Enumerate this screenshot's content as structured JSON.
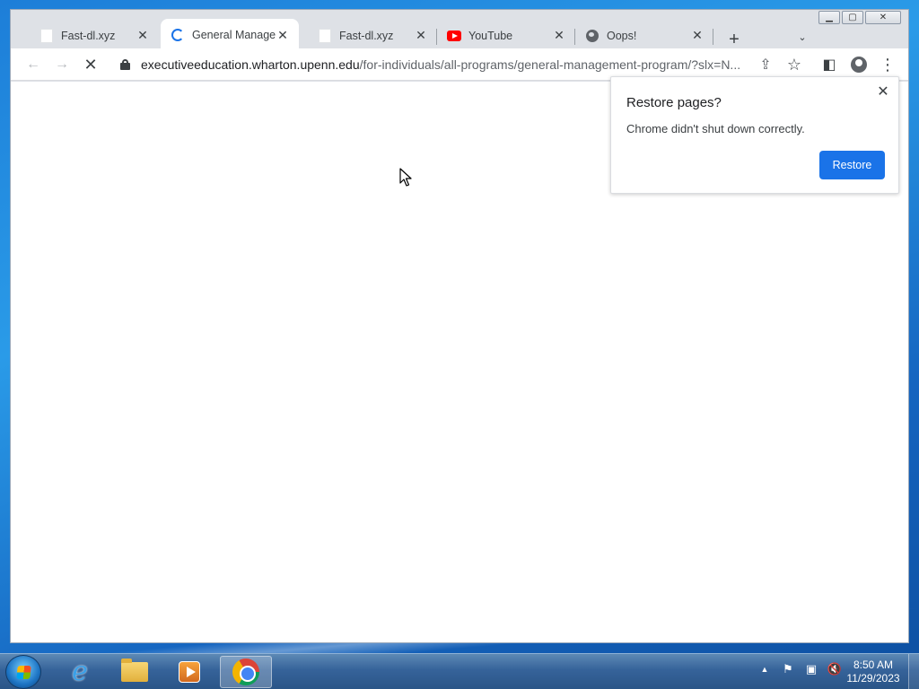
{
  "window": {
    "controls": {
      "minimize": "▁",
      "maximize": "▢",
      "close": "✕"
    }
  },
  "tabs": [
    {
      "title": "Fast-dl.xyz",
      "icon": "blank-page-icon",
      "active": false
    },
    {
      "title": "General Management",
      "icon": "loading-spinner-icon",
      "active": true
    },
    {
      "title": "Fast-dl.xyz",
      "icon": "blank-page-icon",
      "active": false
    },
    {
      "title": "YouTube",
      "icon": "youtube-icon",
      "active": false
    },
    {
      "title": "Oops!",
      "icon": "globe-icon",
      "active": false
    }
  ],
  "tabstrip": {
    "new_tab": "+",
    "tab_search": "⌄",
    "close_glyph": "✕"
  },
  "toolbar": {
    "back": "←",
    "forward": "→",
    "stop": "✕",
    "url_host": "executiveeducation.wharton.upenn.edu",
    "url_path": "/for-individuals/all-programs/general-management-program/?slx=N...",
    "share": "⇪",
    "bookmark": "☆",
    "side_panel": "◧",
    "menu": "⋮"
  },
  "restore_bubble": {
    "title": "Restore pages?",
    "message": "Chrome didn't shut down correctly.",
    "button": "Restore",
    "close": "✕"
  },
  "taskbar": {
    "apps": [
      "start-button",
      "internet-explorer",
      "file-explorer",
      "media-player",
      "google-chrome"
    ],
    "tray": {
      "show_hidden": "▲",
      "flag": "⚑",
      "network": "▣",
      "volume": "🔇"
    },
    "time": "8:50 AM",
    "date": "11/29/2023"
  },
  "colors": {
    "accent": "#1a73e8",
    "tab_strip": "#dee1e6",
    "taskbar": "#36639a"
  }
}
